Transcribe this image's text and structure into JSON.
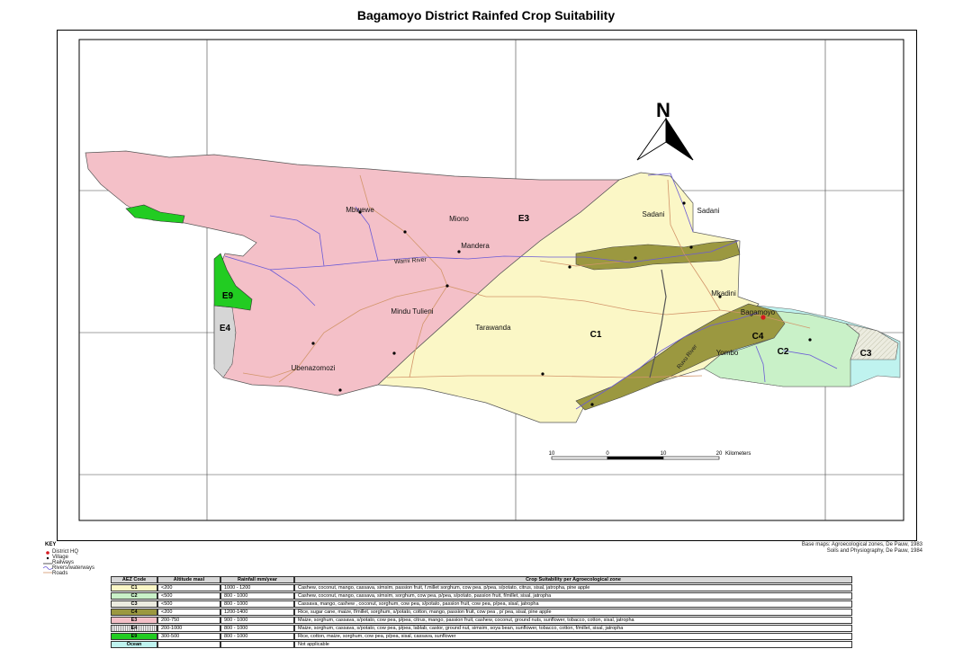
{
  "title": "Bagamoyo District Rainfed Crop Suitability",
  "colors": {
    "E3": "#f4c0c8",
    "C1": "#fbf7c6",
    "C2": "#c9f1c8",
    "C3": "#ecece0",
    "C4": "#9b9840",
    "E9": "#22cc22",
    "Ocean": "#bff3ef",
    "rivers": "#6a5ad6",
    "roads": "#d2956a"
  },
  "north_label": "N",
  "zone_labels": [
    "E3",
    "C1",
    "C2",
    "C3",
    "C4",
    "E9",
    "E4"
  ],
  "places": [
    "Mbwewe",
    "Miono",
    "Sadani",
    "Sadani",
    "Mandera",
    "Mkadini",
    "Bagamoyo",
    "Mindu Tulieni",
    "Tarawanda",
    "Yombo",
    "Ubenazomozi"
  ],
  "river_labels": [
    "Wami River",
    "Ruvu River"
  ],
  "scale": {
    "ticks": [
      "10",
      "0",
      "10",
      "20"
    ],
    "unit": "Kilometers"
  },
  "key": {
    "label": "KEY",
    "items": [
      "District HQ",
      "Village",
      "Railways",
      "Rivers/waterways",
      "Roads"
    ]
  },
  "source": [
    "Base maps: Agroecological zones, De Pauw, 1983",
    "Soils and Physiography, De Pauw, 1984"
  ],
  "table": {
    "headers": [
      "AEZ Code",
      "Altitude masl",
      "Rainfall mm/year",
      "Crop Suitability per Agroecological zone"
    ],
    "rows": [
      {
        "code": "C1",
        "alt": "<200",
        "rain": "1000 - 1200",
        "crops": "Cashew, coconut, mango, cassava, simsim, passion fruit, f.millet sorghum, cow pea, p/pea, s/potato, citrus, sisal, jatropha, pine apple"
      },
      {
        "code": "C2",
        "alt": "<500",
        "rain": "800 - 1000",
        "crops": "Cashew, coconut, mango, cassava, simsim, sorghum, cow pea, p/pea, s/potato, passion fruit, f/millet, sisal, jatropha"
      },
      {
        "code": "C3",
        "alt": "<500",
        "rain": "800 - 1000",
        "crops": "Cassava, mango, cashew , coconut, sorghum, cow pea, s/potato, passion fruit, cow pea, p/pea, sisal, jatropha"
      },
      {
        "code": "C4",
        "alt": "<200",
        "rain": "1200-1400",
        "crops": "Rice, sugar cane, maize, f/millet, sorghum, s/potato, cotton, mango, passion fruit, cow pea , p/ pea, sisal, pine apple"
      },
      {
        "code": "E3",
        "alt": "200-750",
        "rain": "900 - 1000",
        "crops": "Maize, sorghum, cassava, s/potato, cow pea, p/pea, citrus, mango, passion fruit, cashew, coconut, ground nuts, sunflower, tobacco, cotton, sisal, jatropha"
      },
      {
        "code": "E4",
        "alt": "200-1000",
        "rain": "800 - 1000",
        "crops": "Maize, sorghum, cassava, s/potato, cow pea, p/pea, lablab, castor, ground nut, simsim, soya bean, sunflower, tobacco, cotton, f/millet, sisal, jatropha"
      },
      {
        "code": "E9",
        "alt": "300-500",
        "rain": "800 - 1000",
        "crops": "Rice, cotton, maize, sorghum, cow pea, p/pea, sisal, cassava, sunflower"
      },
      {
        "code": "Ocean",
        "alt": "",
        "rain": "",
        "crops": "Not applicable"
      }
    ]
  }
}
